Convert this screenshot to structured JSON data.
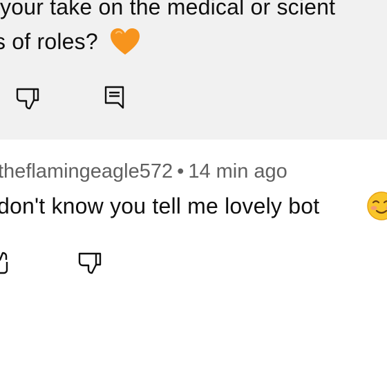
{
  "top_comment": {
    "line1": "your take on the medical or scient",
    "line2": "s of roles?",
    "emoji": "orange-heart-emoji",
    "actions": {
      "dislike": "thumbs-down-icon",
      "reply": "reply-comment-icon"
    },
    "colors": {
      "background": "#f1f1f1",
      "heart": "#f7941d"
    }
  },
  "second_comment": {
    "username": "theflamingeagle572",
    "separator": "•",
    "time": "14 min ago",
    "text": "don't know you tell me lovely bot",
    "emoji": "blushing-smiley-emoji",
    "actions": {
      "like": "thumbs-up-icon",
      "dislike": "thumbs-down-icon"
    },
    "colors": {
      "meta": "#606060",
      "text": "#0f0f0f"
    }
  }
}
